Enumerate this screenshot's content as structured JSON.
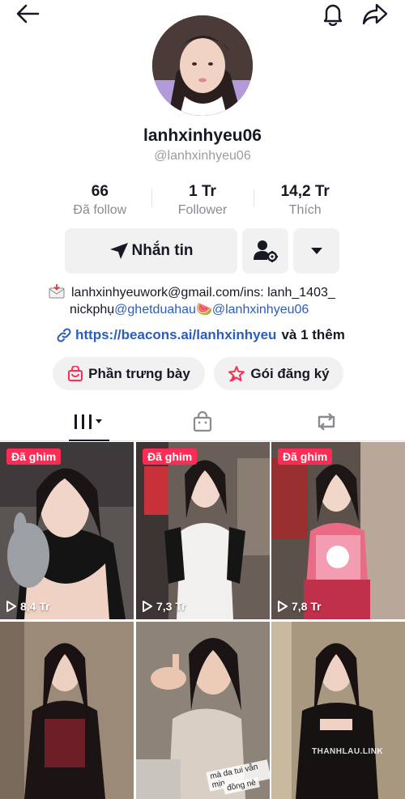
{
  "profile": {
    "username": "lanhxinhyeu06",
    "handle": "@lanhxinhyeu06"
  },
  "stats": [
    {
      "value": "66",
      "label": "Đã follow"
    },
    {
      "value": "1 Tr",
      "label": "Follower"
    },
    {
      "value": "14,2 Tr",
      "label": "Thích"
    }
  ],
  "actions": {
    "message_label": "Nhắn tin"
  },
  "bio": {
    "line1": "lanhxinhyeuwork@gmail.com/ins: lanh_1403_",
    "line2_prefix": "nickphụ",
    "mention1": "@ghetduahau",
    "emoji": "🍉",
    "mention2": "@lanhxinhyeu06",
    "link": "https://beacons.ai/lanhxinhyeu",
    "link_more": "và 1 thêm"
  },
  "chips": {
    "showcase": "Phần trưng bày",
    "subscription": "Gói đăng ký"
  },
  "videos": [
    {
      "pinned": "Đã ghim",
      "views": "8,4 Tr"
    },
    {
      "pinned": "Đã ghim",
      "views": "7,3 Tr"
    },
    {
      "pinned": "Đã ghim",
      "views": "7,8 Tr"
    },
    {
      "pinned": "",
      "views": ""
    },
    {
      "pinned": "",
      "views": "",
      "caption_line1": "mà da tui vẫn mịn",
      "caption_line2": "đồng nè"
    },
    {
      "pinned": "",
      "views": "",
      "watermark": "THANHLAU.LINK"
    }
  ],
  "colors": {
    "accent_red": "#fe2c55",
    "link_blue": "#2b5db9",
    "button_grey": "#f1f1f2"
  }
}
